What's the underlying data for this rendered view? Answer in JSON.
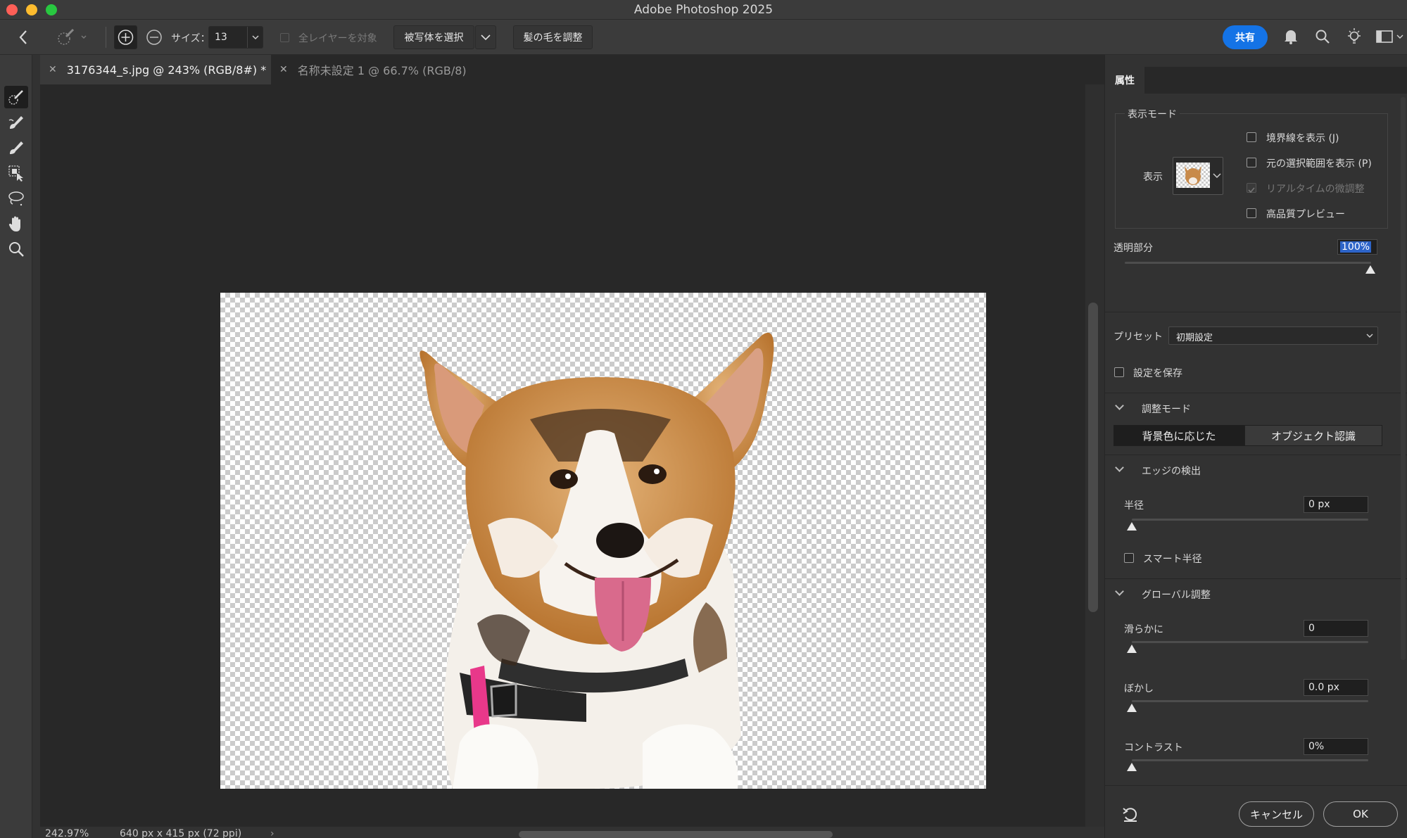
{
  "window": {
    "title": "Adobe Photoshop 2025"
  },
  "options_bar": {
    "size_label": "サイズ：",
    "size_value": "13",
    "all_layers_label": "全レイヤーを対象",
    "select_subject_label": "被写体を選択",
    "refine_hair_label": "髪の毛を調整",
    "share_label": "共有"
  },
  "tabs": [
    {
      "label": "3176344_s.jpg @ 243% (RGB/8#) *",
      "active": true
    },
    {
      "label": "名称未設定 1 @ 66.7% (RGB/8)",
      "active": false
    }
  ],
  "status": {
    "zoom": "242.97%",
    "doc_info": "640 px x 415 px (72 ppi)"
  },
  "panel": {
    "tab_label": "属性",
    "view_mode": {
      "section_label": "表示モード",
      "view_label": "表示",
      "checkboxes": [
        {
          "label": "境界線を表示 (J)",
          "checked": false,
          "disabled": false
        },
        {
          "label": "元の選択範囲を表示 (P)",
          "checked": false,
          "disabled": false
        },
        {
          "label": "リアルタイムの微調整",
          "checked": true,
          "disabled": true
        },
        {
          "label": "高品質プレビュー",
          "checked": false,
          "disabled": false
        }
      ],
      "transparency_label": "透明部分",
      "transparency_value": "100%",
      "transparency_level": 1.0
    },
    "preset_label": "プリセット",
    "preset_value": "初期設定",
    "save_settings_label": "設定を保存",
    "refine_mode": {
      "section_label": "調整モード",
      "options": [
        "背景色に応じた",
        "オブジェクト認識"
      ],
      "selected": "背景色に応じた"
    },
    "edge_detection": {
      "section_label": "エッジの検出",
      "radius_label": "半径",
      "radius_value": "0 px",
      "smart_radius_label": "スマート半径"
    },
    "global_refinements": {
      "section_label": "グローバル調整",
      "smooth_label": "滑らかに",
      "smooth_value": "0",
      "feather_label": "ぼかし",
      "feather_value": "0.0 px",
      "contrast_label": "コントラスト",
      "contrast_value": "0%"
    },
    "cancel_label": "キャンセル",
    "ok_label": "OK"
  },
  "colors": {
    "accent": "#1473e6",
    "close": "#ff5f57",
    "minimize": "#febc2e",
    "zoom": "#28c840"
  }
}
